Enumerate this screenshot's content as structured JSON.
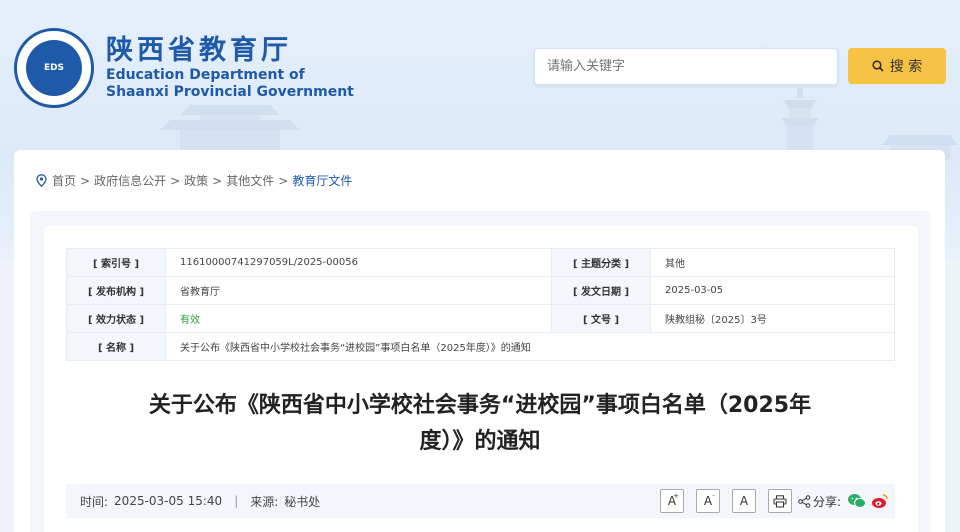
{
  "header": {
    "name_cn": "陕西省教育厅",
    "name_en_line1": "Education Department of",
    "name_en_line2": "Shaanxi Provincial Government",
    "emblem_text": "EDS"
  },
  "search": {
    "placeholder": "请输入关键字",
    "button_label": "搜 索"
  },
  "breadcrumb": [
    {
      "label": "首页"
    },
    {
      "label": "政府信息公开"
    },
    {
      "label": "政策"
    },
    {
      "label": "其他文件"
    },
    {
      "label": "教育厅文件"
    }
  ],
  "meta": {
    "index_label": "[ 索引号 ]",
    "index_value": "11610000741297059L/2025-00056",
    "category_label": "[ 主题分类 ]",
    "category_value": "其他",
    "publisher_label": "[ 发布机构 ]",
    "publisher_value": "省教育厅",
    "date_label": "[ 发文日期 ]",
    "date_value": "2025-03-05",
    "status_label": "[ 效力状态 ]",
    "status_value": "有效",
    "docno_label": "[ 文号 ]",
    "docno_value": "陕教组秘〔2025〕3号",
    "name_label": "[ 名称 ]",
    "name_value": "关于公布《陕西省中小学校社会事务“进校园”事项白名单（2025年度）》的通知"
  },
  "article": {
    "title_line1": "关于公布《陕西省中小学校社会事务“进校园”事项白名单（2025年",
    "title_line2": "度）》的通知",
    "time_label": "时间:",
    "time_value": "2025-03-05 15:40",
    "divider": "|",
    "source_label": "来源:",
    "source_value": "秘书处"
  },
  "tools": {
    "font_large": "A",
    "font_small": "A",
    "font_normal": "A",
    "share_label": "分享:"
  },
  "colors": {
    "brand": "#1f5aa8",
    "search_button": "#f6c244",
    "status_green": "#2d9b3a"
  }
}
